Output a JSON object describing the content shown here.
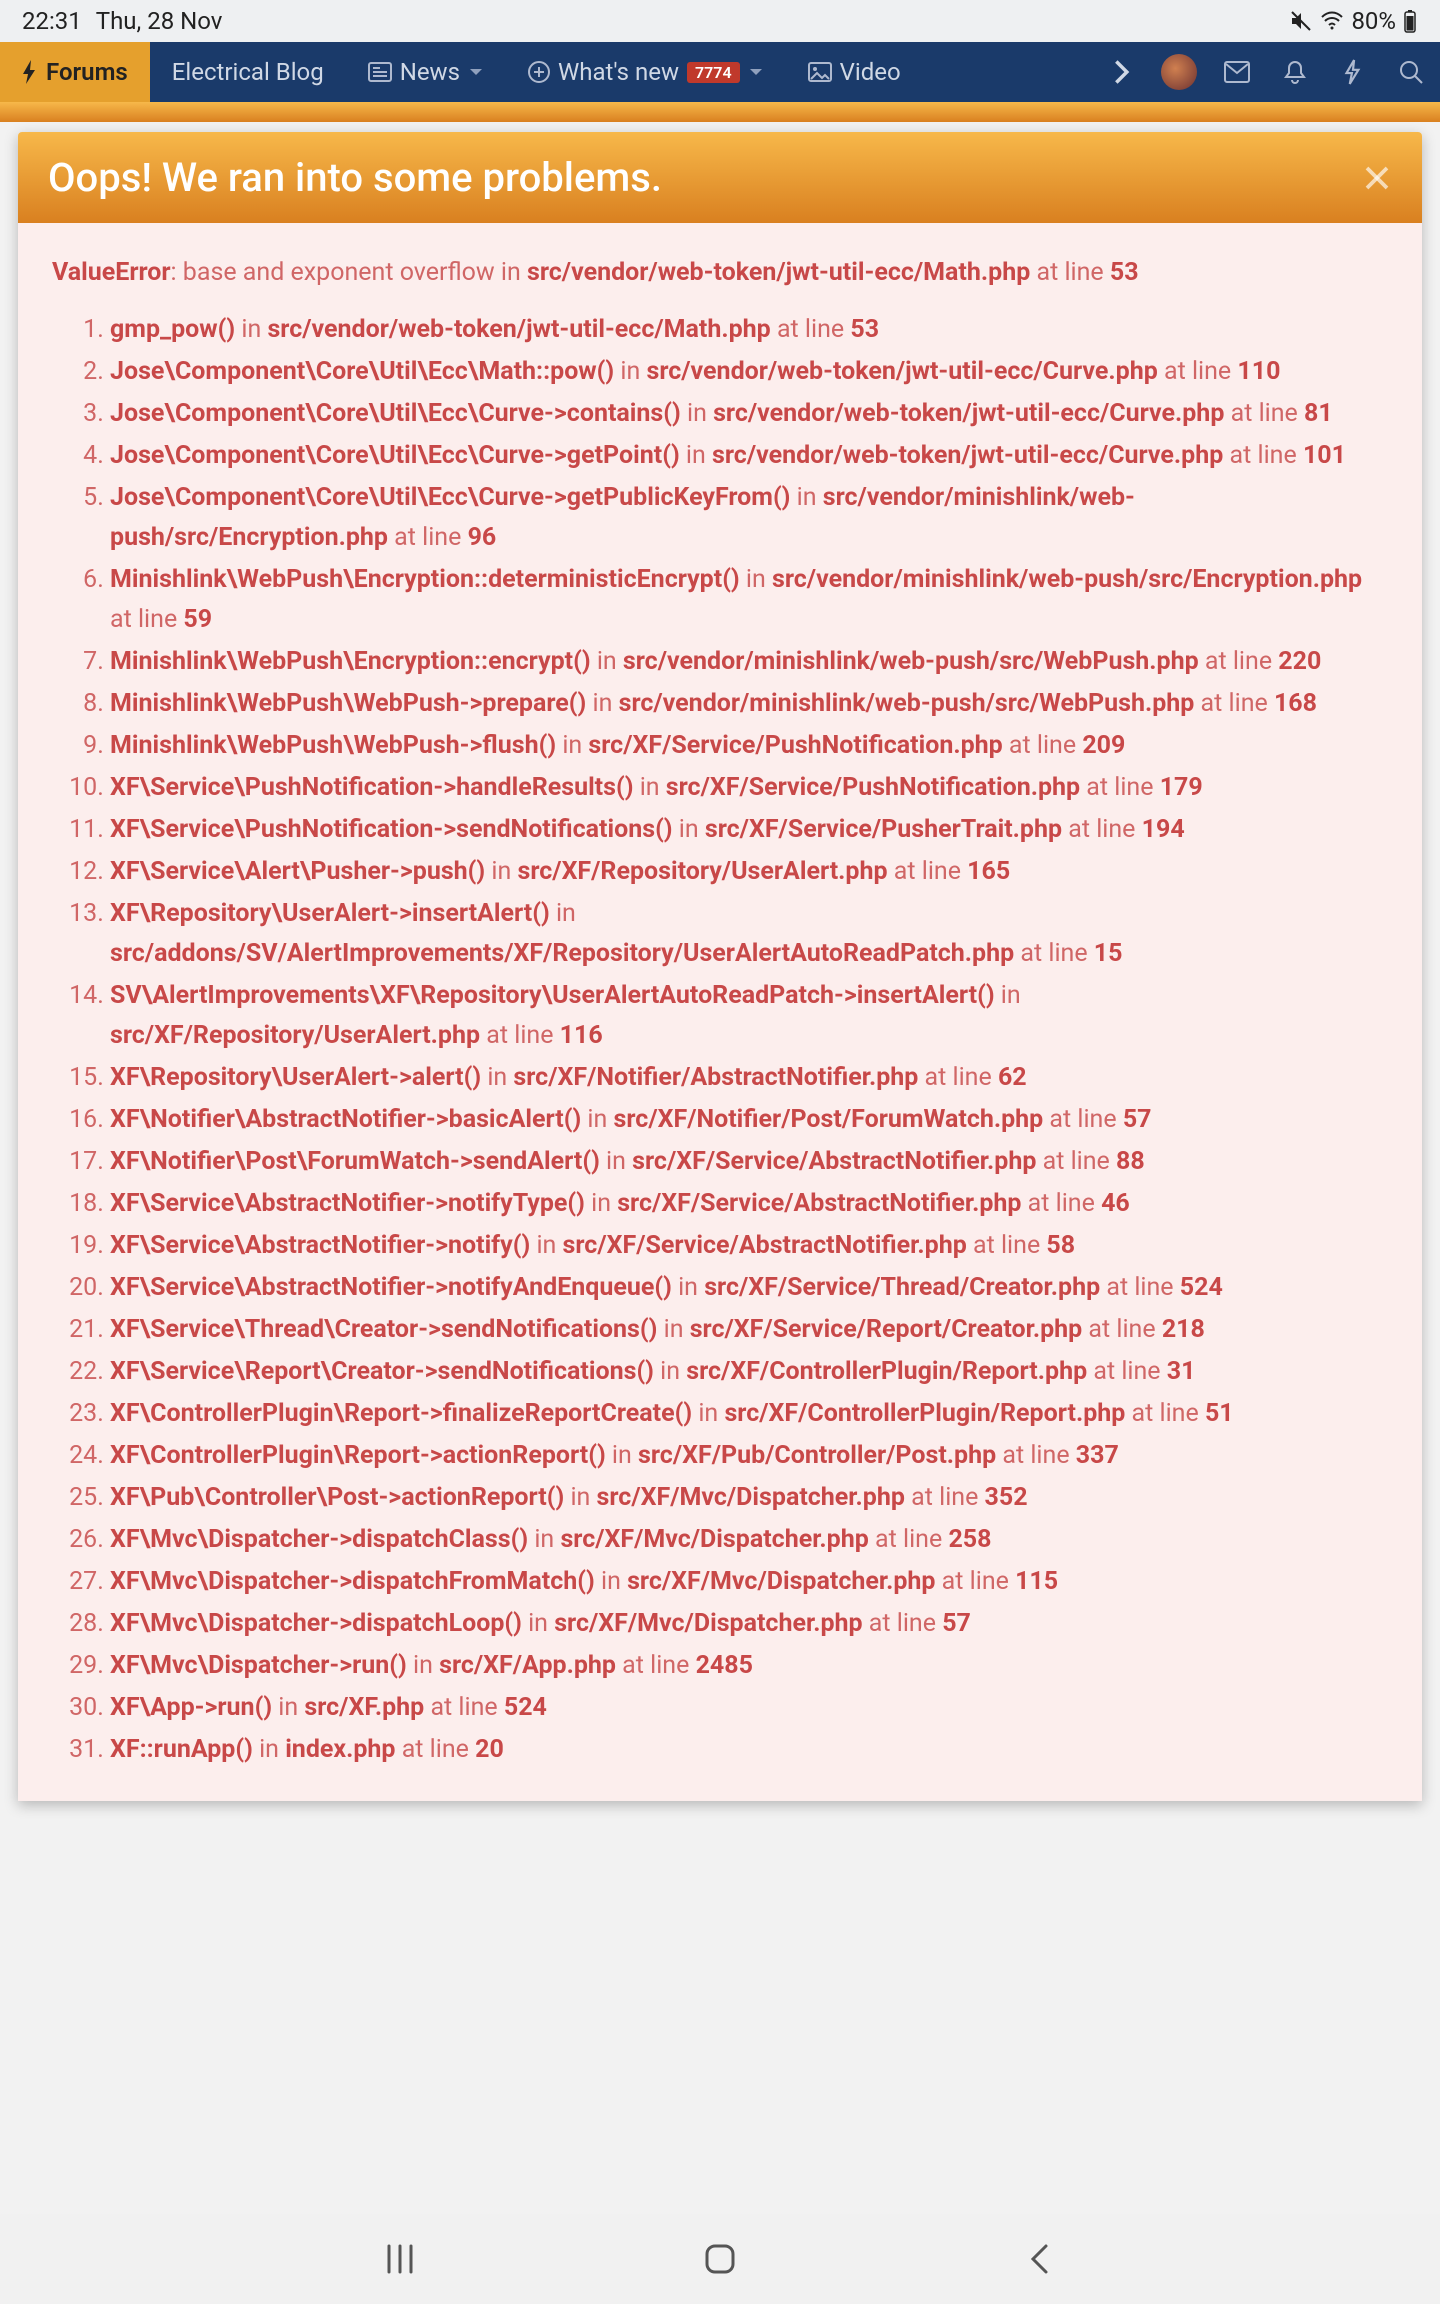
{
  "statusbar": {
    "time": "22:31",
    "date": "Thu, 28 Nov",
    "battery": "80%"
  },
  "nav": {
    "forums": "Forums",
    "blog": "Electrical Blog",
    "news": "News",
    "whatsnew": "What's new",
    "whatsnew_badge": "7774",
    "video": "Video"
  },
  "overlay": {
    "title": "Oops! We ran into some problems."
  },
  "error": {
    "exception": "ValueError",
    "message": ": base and exponent overflow in ",
    "file": "src/vendor/web-token/jwt-util-ecc/Math.php",
    "at": " at line ",
    "line": "53"
  },
  "in_word": " in ",
  "at_line": " at line ",
  "trace": [
    {
      "fn": "gmp_pow()",
      "file": "src/vendor/web-token/jwt-util-ecc/Math.php",
      "line": "53"
    },
    {
      "fn": "Jose\\Component\\Core\\Util\\Ecc\\Math::pow()",
      "file": "src/vendor/web-token/jwt-util-ecc/Curve.php",
      "line": "110"
    },
    {
      "fn": "Jose\\Component\\Core\\Util\\Ecc\\Curve->contains()",
      "file": "src/vendor/web-token/jwt-util-ecc/Curve.php",
      "line": "81"
    },
    {
      "fn": "Jose\\Component\\Core\\Util\\Ecc\\Curve->getPoint()",
      "file": "src/vendor/web-token/jwt-util-ecc/Curve.php",
      "line": "101"
    },
    {
      "fn": "Jose\\Component\\Core\\Util\\Ecc\\Curve->getPublicKeyFrom()",
      "file": "src/vendor/minishlink/web-push/src/Encryption.php",
      "line": "96"
    },
    {
      "fn": "Minishlink\\WebPush\\Encryption::deterministicEncrypt()",
      "file": "src/vendor/minishlink/web-push/src/Encryption.php",
      "line": "59"
    },
    {
      "fn": "Minishlink\\WebPush\\Encryption::encrypt()",
      "file": "src/vendor/minishlink/web-push/src/WebPush.php",
      "line": "220"
    },
    {
      "fn": "Minishlink\\WebPush\\WebPush->prepare()",
      "file": "src/vendor/minishlink/web-push/src/WebPush.php",
      "line": "168"
    },
    {
      "fn": "Minishlink\\WebPush\\WebPush->flush()",
      "file": "src/XF/Service/PushNotification.php",
      "line": "209"
    },
    {
      "fn": "XF\\Service\\PushNotification->handleResults()",
      "file": "src/XF/Service/PushNotification.php",
      "line": "179"
    },
    {
      "fn": "XF\\Service\\PushNotification->sendNotifications()",
      "file": "src/XF/Service/PusherTrait.php",
      "line": "194"
    },
    {
      "fn": "XF\\Service\\Alert\\Pusher->push()",
      "file": "src/XF/Repository/UserAlert.php",
      "line": "165"
    },
    {
      "fn": "XF\\Repository\\UserAlert->insertAlert()",
      "file": "src/addons/SV/AlertImprovements/XF/Repository/UserAlertAutoReadPatch.php",
      "line": "15"
    },
    {
      "fn": "SV\\AlertImprovements\\XF\\Repository\\UserAlertAutoReadPatch->insertAlert()",
      "file": "src/XF/Repository/UserAlert.php",
      "line": "116"
    },
    {
      "fn": "XF\\Repository\\UserAlert->alert()",
      "file": "src/XF/Notifier/AbstractNotifier.php",
      "line": "62"
    },
    {
      "fn": "XF\\Notifier\\AbstractNotifier->basicAlert()",
      "file": "src/XF/Notifier/Post/ForumWatch.php",
      "line": "57"
    },
    {
      "fn": "XF\\Notifier\\Post\\ForumWatch->sendAlert()",
      "file": "src/XF/Service/AbstractNotifier.php",
      "line": "88"
    },
    {
      "fn": "XF\\Service\\AbstractNotifier->notifyType()",
      "file": "src/XF/Service/AbstractNotifier.php",
      "line": "46"
    },
    {
      "fn": "XF\\Service\\AbstractNotifier->notify()",
      "file": "src/XF/Service/AbstractNotifier.php",
      "line": "58"
    },
    {
      "fn": "XF\\Service\\AbstractNotifier->notifyAndEnqueue()",
      "file": "src/XF/Service/Thread/Creator.php",
      "line": "524"
    },
    {
      "fn": "XF\\Service\\Thread\\Creator->sendNotifications()",
      "file": "src/XF/Service/Report/Creator.php",
      "line": "218"
    },
    {
      "fn": "XF\\Service\\Report\\Creator->sendNotifications()",
      "file": "src/XF/ControllerPlugin/Report.php",
      "line": "31"
    },
    {
      "fn": "XF\\ControllerPlugin\\Report->finalizeReportCreate()",
      "file": "src/XF/ControllerPlugin/Report.php",
      "line": "51"
    },
    {
      "fn": "XF\\ControllerPlugin\\Report->actionReport()",
      "file": "src/XF/Pub/Controller/Post.php",
      "line": "337"
    },
    {
      "fn": "XF\\Pub\\Controller\\Post->actionReport()",
      "file": "src/XF/Mvc/Dispatcher.php",
      "line": "352"
    },
    {
      "fn": "XF\\Mvc\\Dispatcher->dispatchClass()",
      "file": "src/XF/Mvc/Dispatcher.php",
      "line": "258"
    },
    {
      "fn": "XF\\Mvc\\Dispatcher->dispatchFromMatch()",
      "file": "src/XF/Mvc/Dispatcher.php",
      "line": "115"
    },
    {
      "fn": "XF\\Mvc\\Dispatcher->dispatchLoop()",
      "file": "src/XF/Mvc/Dispatcher.php",
      "line": "57"
    },
    {
      "fn": "XF\\Mvc\\Dispatcher->run()",
      "file": "src/XF/App.php",
      "line": "2485"
    },
    {
      "fn": "XF\\App->run()",
      "file": "src/XF.php",
      "line": "524"
    },
    {
      "fn": "XF::runApp()",
      "file": "index.php",
      "line": "20"
    }
  ]
}
